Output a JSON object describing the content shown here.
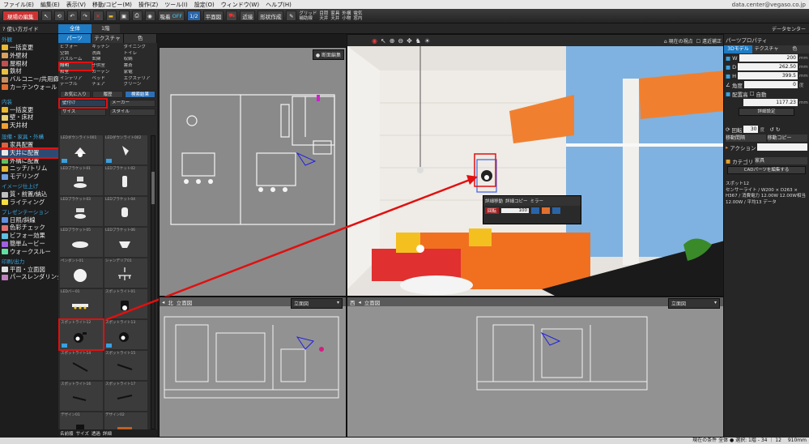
{
  "menubar": {
    "items": [
      "ファイル(E)",
      "編集(E)",
      "表示(V)",
      "移動/コピー(M)",
      "操作(Z)",
      "ツール(I)",
      "設定(O)",
      "ウィンドウ(W)",
      "ヘルプ(H)"
    ],
    "account": "data.center@vegaso.co.jp"
  },
  "toolbar": {
    "projectButton": "現場の編集",
    "toggleLabel": "吸着",
    "toggleState": "OFF",
    "scale": "1/2",
    "planButton": "平面図",
    "nearbyLabel": "近接",
    "traceButton": "形状作成",
    "checks": [
      "グリッド",
      "補助線",
      "目隠",
      "天井",
      "家具",
      "天井",
      "外構",
      "小物",
      "電気",
      "窓内"
    ]
  },
  "row2": {
    "guide": "使い方ガイド",
    "tabs": [
      "全体",
      "1階"
    ],
    "dataCenter": "データセンター"
  },
  "left": {
    "sections": [
      {
        "title": "外観",
        "items": [
          "一括変更",
          "外壁材",
          "屋根材",
          "鉄材",
          "バルコニー/共用廊下",
          "カーテンウォール"
        ]
      },
      {
        "title": "内装",
        "items": [
          "一括変更",
          "壁・床材",
          "天井材"
        ]
      },
      {
        "title": "設備・家具・外構",
        "items": [
          "家具配置",
          "天井に配置",
          "外構に配置",
          "ニッチ/トリム",
          "モデリング"
        ]
      },
      {
        "title": "イメージ仕上げ",
        "items": [
          "質・前置/納込",
          "ライティング"
        ]
      },
      {
        "title": "プレゼンテーション",
        "items": [
          "日照/斜線",
          "色彩チェック",
          "ビフォー効果",
          "簡単ムービー",
          "ウォークスルー"
        ]
      },
      {
        "title": "印刷/出力",
        "items": [
          "平面・立面図",
          "パースレンダリング"
        ]
      }
    ]
  },
  "panel": {
    "tabs": [
      "パーツ",
      "テクスチャ",
      "色"
    ],
    "categories": [
      "ビフォー",
      "キッチン",
      "ダイニング",
      "空調",
      "洗面",
      "トイレ",
      "バスルーム",
      "玄関",
      "収納",
      "照明",
      "子供室",
      "書斎",
      "和室",
      "カーテン",
      "家電",
      "インテリア",
      "ベッド",
      "エクステリア",
      "テーブル",
      "チェア",
      "グリーン"
    ],
    "buttons": [
      "お気に入り",
      "履歴",
      "検索結果"
    ],
    "filter1": "壁付け",
    "filter1b": "メーカー",
    "filter2": "サイズ",
    "filter2b": "スタイル",
    "items": [
      "LEDダウンライト001",
      "LEDダウンライト002",
      "LEDブラケット01",
      "LEDブラケット02",
      "LEDブラケット03",
      "LEDブラケット04",
      "LEDブラケット05",
      "LEDブラケット06",
      "ペンダント01",
      "シャンデリア01",
      "LEDバー01",
      "スポットライト01",
      "スポットライト12",
      "スポットライト13",
      "スポットライト14",
      "スポットライト15",
      "スポットライト16",
      "スポットライト17",
      "デザイン01",
      "デザイン02"
    ],
    "bottom": [
      "名前順",
      "サイズ",
      "透過",
      "詳細"
    ]
  },
  "views": {
    "topright": "断面編集",
    "perspective": "現在の視点",
    "perspectiveFix": "遠近補正",
    "north": "北",
    "elevation1": "立面図",
    "west": "西",
    "elevation2": "立面図",
    "dropdown": "立面図"
  },
  "popup": {
    "opt1": "詳細移動",
    "opt2": "詳細コピー",
    "opt3": "ミラー",
    "label": "回転",
    "value": "100"
  },
  "right": {
    "title": "パーツプロパティ",
    "tabs": [
      "3Dモデル",
      "テクスチャ",
      "色"
    ],
    "fields": [
      {
        "label": "W",
        "value": "200",
        "unit": "mm"
      },
      {
        "label": "D",
        "value": "262.50",
        "unit": "mm"
      },
      {
        "label": "H",
        "value": "399.5",
        "unit": "mm"
      },
      {
        "label": "角度",
        "value": "0",
        "unit": "度"
      }
    ],
    "place": "配置高",
    "auto": "自動",
    "placeValue": "1177.23",
    "placeUnit": "mm",
    "detailBtn": "詳細設定",
    "rotate": "回転",
    "rotateValue": "30",
    "rotateUnit": "度",
    "move": "移動間隔",
    "copy": "移動コピー",
    "action": "アクション",
    "category": "カテゴリ",
    "categoryValue": "家具",
    "cadButton": "CADパーツを編集する",
    "infoName": "スポット12",
    "infoText": "センサーライト / W200 × D263 × H367 / 消費電力 12.00W 12.00W相当 12.00W / 平均13 データ"
  },
  "status": "現在の条件 全体 ● 選択: 1階 - 34 ｜ 12 　910mm"
}
